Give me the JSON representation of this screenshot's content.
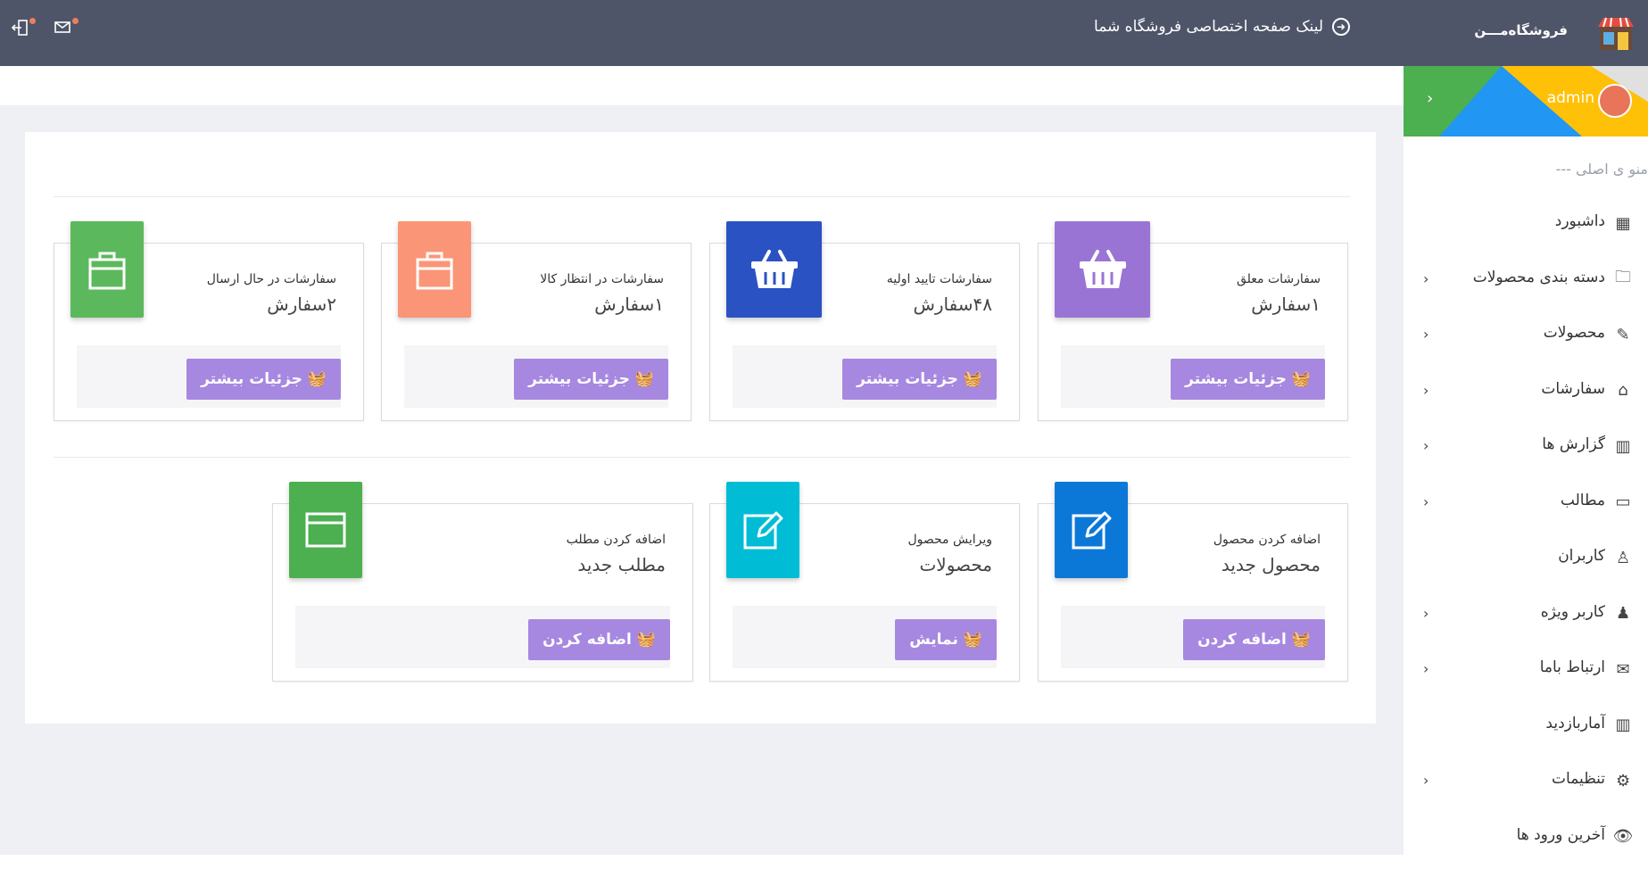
{
  "header": {
    "shop_link": "لینک صفحه اختصاصی فروشگاه شما",
    "logout_icon": "logout-icon",
    "mail_icon": "mail-icon"
  },
  "brand": {
    "name": "فروشگاه‌مـــن"
  },
  "user": {
    "name": "admin"
  },
  "menu": {
    "section": "منو ی اصلی ---",
    "items": [
      {
        "label": "داشبورد",
        "icon": "dashboard-icon",
        "has_arrow": false
      },
      {
        "label": "دسته بندی محصولات",
        "icon": "folder-icon",
        "has_arrow": true
      },
      {
        "label": "محصولات",
        "icon": "edit-icon",
        "has_arrow": true
      },
      {
        "label": "سفارشات",
        "icon": "basket-icon",
        "has_arrow": true
      },
      {
        "label": "گزارش ها",
        "icon": "bar-chart-icon",
        "has_arrow": true
      },
      {
        "label": "مطالب",
        "icon": "window-icon",
        "has_arrow": true
      },
      {
        "label": "کاربران",
        "icon": "user-icon",
        "has_arrow": false
      },
      {
        "label": "کاربر ویژه",
        "icon": "user-solid-icon",
        "has_arrow": true
      },
      {
        "label": "ارتباط باما",
        "icon": "envelope-icon",
        "has_arrow": true
      },
      {
        "label": "آماربازدید",
        "icon": "stats-icon",
        "has_arrow": false
      },
      {
        "label": "تنظیمات",
        "icon": "gear-icon",
        "has_arrow": true
      },
      {
        "label": "آخرین ورود ها",
        "icon": "eye-icon",
        "has_arrow": false
      }
    ]
  },
  "orders": [
    {
      "title": "سفارشات معلق",
      "value": "۱سفارش",
      "button": "جزئیات بیشتر",
      "color": "#9a74d5",
      "icon": "basket-icon"
    },
    {
      "title": "سفارشات تایید اولیه",
      "value": "۴۸سفارش",
      "button": "جزئیات بیشتر",
      "color": "#2b52c2",
      "icon": "basket-icon"
    },
    {
      "title": "سفارشات در انتظار کالا",
      "value": "۱سفارش",
      "button": "جزئیات بیشتر",
      "color": "#fb9577",
      "icon": "shopping-bag-icon"
    },
    {
      "title": "سفارشات در حال ارسال",
      "value": "۲سفارش",
      "button": "جزئیات بیشتر",
      "color": "#5cb85c",
      "icon": "shopping-bag-icon"
    }
  ],
  "actions": [
    {
      "title": "اضافه کردن محصول",
      "value": "محصول جدید",
      "button": "اضافه کردن",
      "color": "#0b78d8",
      "icon": "edit-icon"
    },
    {
      "title": "ویرایش محصول",
      "value": "محصولات",
      "button": "نمایش",
      "color": "#00bcd4",
      "icon": "edit-icon"
    },
    {
      "title": "اضافه کردن مطلب",
      "value": "مطلب جدید",
      "button": "اضافه کردن",
      "color": "#4caf50",
      "icon": "window-icon"
    }
  ]
}
